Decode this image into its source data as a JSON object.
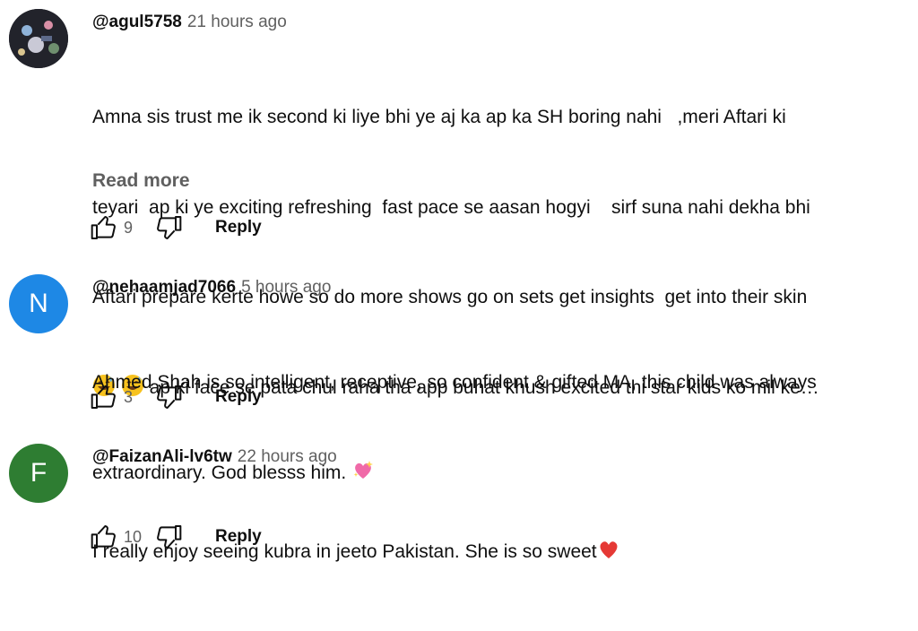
{
  "comments": [
    {
      "handle": "@agul5758",
      "time": "21 hours ago",
      "lines": [
        "Amna sis trust me ik second ki liye bhi ye aj ka ap ka SH boring nahi   ,meri Aftari ki",
        "teyari  ap ki ye exciting refreshing  fast pace se aasan hogyi    sirf suna nahi dekha bhi",
        "Aftari prepare kerte howe so do more shows go on sets get insights  get into their skin",
        "  ap ki face se pata chul raha tha app buhat khush excited thi star  kids  ko mil ke…"
      ],
      "read_more": "Read more",
      "likes": "9",
      "reply": "Reply",
      "avatar_icon": "photo-avatar"
    },
    {
      "handle": "@nehaamjad7066",
      "time": "5 hours ago",
      "lines": [
        "Ahmed Shah is so intelligent, receptive, so confident & gifted MA, this child was always",
        "extraordinary. God blesss him. "
      ],
      "likes": "3",
      "reply": "Reply",
      "avatar_letter": "N",
      "avatar_color": "#1e88e5"
    },
    {
      "handle": "@FaizanAli-lv6tw",
      "time": "22 hours ago",
      "lines": [
        "I really enjoy seeing kubra in jeeto Pakistan. She is so sweet"
      ],
      "likes": "10",
      "reply": "Reply",
      "avatar_letter": "F",
      "avatar_color": "#2e7d32"
    }
  ],
  "icons": {
    "like": "thumbs-up-icon",
    "dislike": "thumbs-down-icon",
    "emoji_smile": "grinning-sweat-emoji",
    "emoji_heart_sparkle": "sparkling-heart-emoji",
    "emoji_heart": "red-heart-emoji"
  }
}
